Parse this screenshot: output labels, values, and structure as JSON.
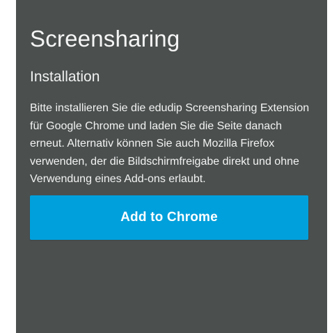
{
  "panel": {
    "title": "Screensharing",
    "subtitle": "Installation",
    "description": "Bitte installieren Sie die edudip Screensharing Extension für Google Chrome und laden Sie die Seite danach erneut. Alternativ können Sie auch Mozilla Firefox verwenden, der die Bildschirmfreigabe direkt und ohne Verwendung eines Add-ons erlaubt.",
    "button_label": "Add to Chrome"
  },
  "colors": {
    "panel_background": "#4b504f",
    "button_background": "#00a0dc",
    "text": "#ffffff"
  }
}
